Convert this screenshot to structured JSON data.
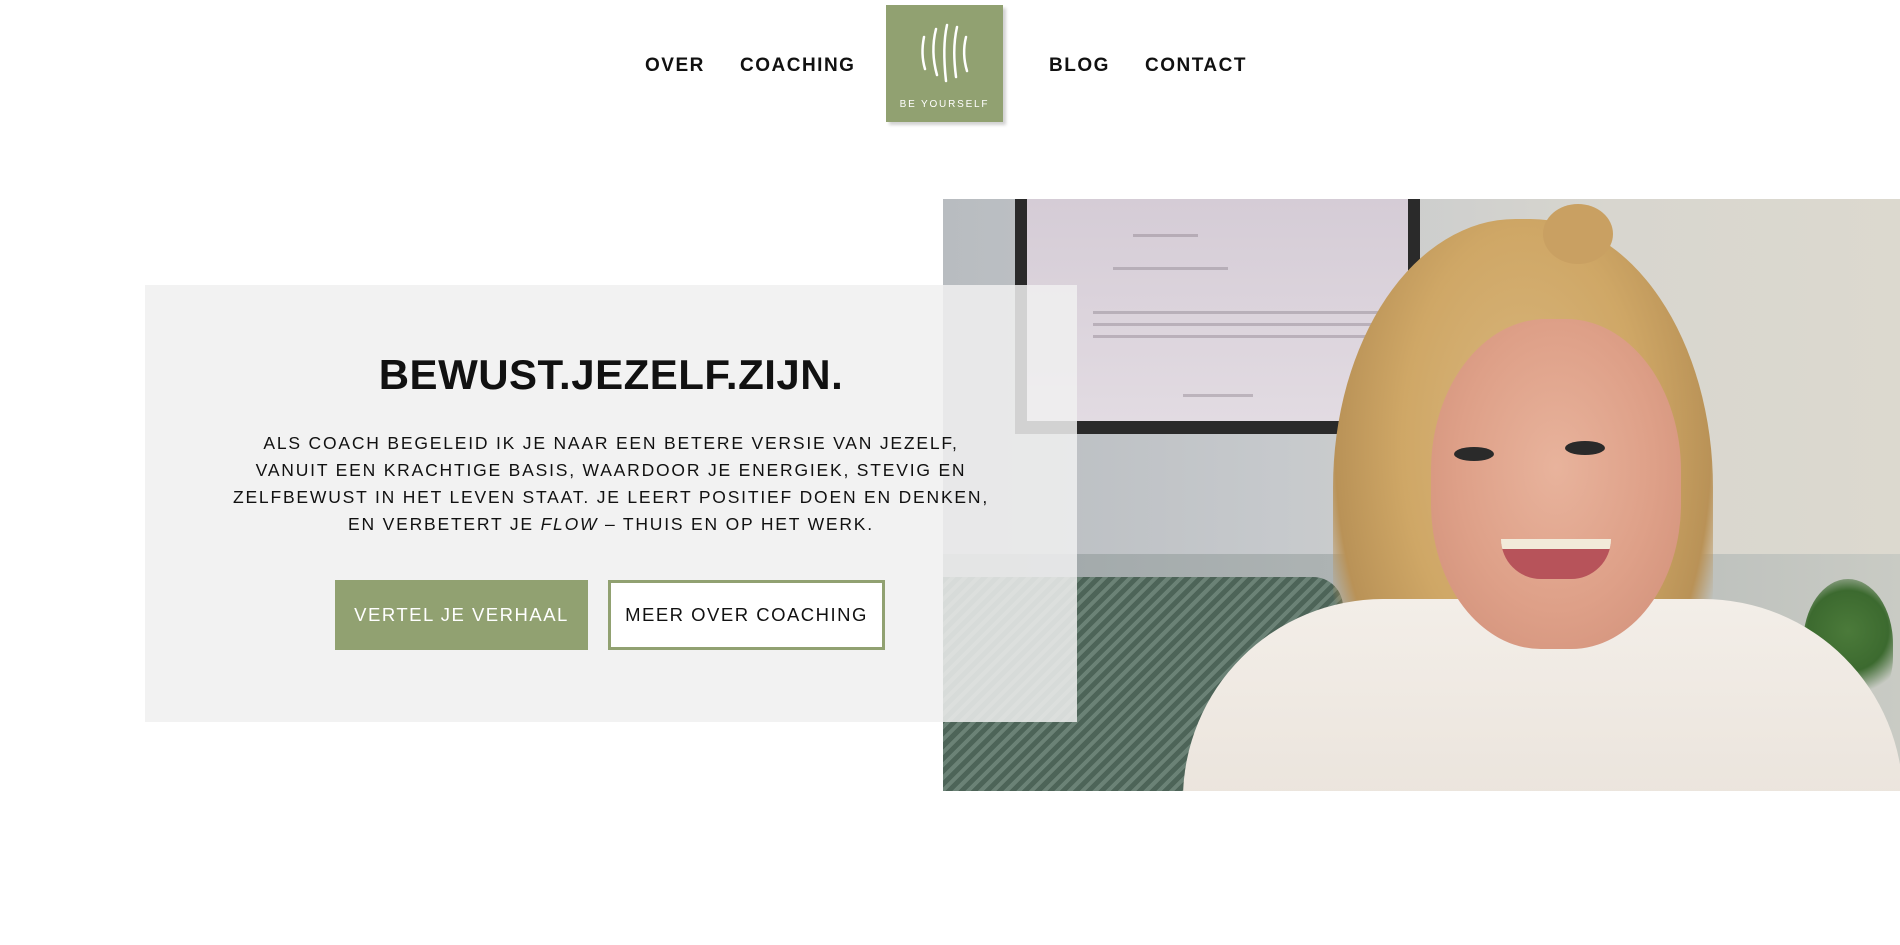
{
  "nav": {
    "items": [
      {
        "label": "OVER"
      },
      {
        "label": "COACHING"
      },
      {
        "label": "BLOG"
      },
      {
        "label": "CONTACT"
      }
    ],
    "logo_text": "BE YOURSELF"
  },
  "hero": {
    "title": "BEWUST.JEZELF.ZIJN.",
    "text_main": "ALS COACH BEGELEID IK JE NAAR EEN BETERE VERSIE VAN JEZELF, VANUIT EEN KRACHTIGE BASIS, WAARDOOR JE ENERGIEK, STEVIG EN ZELFBEWUST IN HET LEVEN STAAT. JE LEERT POSITIEF  DOEN EN DENKEN,  EN VERBETERT JE ",
    "text_italic": "FLOW",
    "text_end": " – THUIS EN OP HET WERK.",
    "primary_button": "VERTEL JE VERHAAL",
    "secondary_button": "MEER OVER COACHING"
  },
  "colors": {
    "accent": "#91a171",
    "panel": "#f0f0f0",
    "text": "#111111"
  }
}
